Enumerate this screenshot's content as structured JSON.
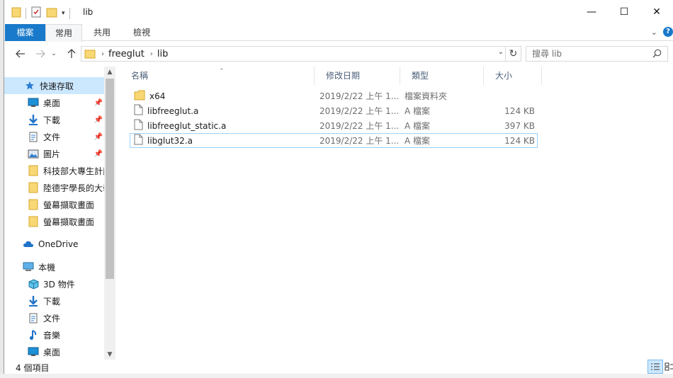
{
  "window": {
    "title": "lib",
    "controls": {
      "minimize": "—",
      "maximize": "☐",
      "close": "✕"
    }
  },
  "ribbon": {
    "tabs": [
      {
        "label": "檔案"
      },
      {
        "label": "常用"
      },
      {
        "label": "共用"
      },
      {
        "label": "檢視"
      }
    ]
  },
  "address": {
    "crumbs": [
      "freeglut",
      "lib"
    ],
    "search_placeholder": "搜尋 lib"
  },
  "nav": {
    "items": [
      {
        "label": "快速存取",
        "icon": "star-icon"
      },
      {
        "label": "桌面",
        "icon": "desktop-icon",
        "pinned": true
      },
      {
        "label": "下載",
        "icon": "download-icon",
        "pinned": true
      },
      {
        "label": "文件",
        "icon": "document-icon",
        "pinned": true
      },
      {
        "label": "圖片",
        "icon": "picture-icon",
        "pinned": true
      },
      {
        "label": "科技部大專生計劃",
        "icon": "folder-icon"
      },
      {
        "label": "陸德宇學長的大學",
        "icon": "folder-icon"
      },
      {
        "label": "螢幕擷取畫面",
        "icon": "folder-icon"
      },
      {
        "label": "螢幕擷取畫面",
        "icon": "folder-icon"
      },
      {
        "label": "OneDrive",
        "icon": "cloud-icon"
      },
      {
        "label": "本機",
        "icon": "computer-icon"
      },
      {
        "label": "3D 物件",
        "icon": "cube-icon"
      },
      {
        "label": "下載",
        "icon": "download-icon"
      },
      {
        "label": "文件",
        "icon": "document-icon"
      },
      {
        "label": "音樂",
        "icon": "music-icon"
      },
      {
        "label": "桌面",
        "icon": "desktop-icon"
      }
    ]
  },
  "columns": {
    "name": "名稱",
    "date": "修改日期",
    "type": "類型",
    "size": "大小"
  },
  "files": [
    {
      "name": "x64",
      "date": "2019/2/22 上午 1...",
      "type": "檔案資料夾",
      "size": "",
      "kind": "folder"
    },
    {
      "name": "libfreeglut.a",
      "date": "2019/2/22 上午 1...",
      "type": "A 檔案",
      "size": "124 KB",
      "kind": "file"
    },
    {
      "name": "libfreeglut_static.a",
      "date": "2019/2/22 上午 1...",
      "type": "A 檔案",
      "size": "397 KB",
      "kind": "file"
    },
    {
      "name": "libglut32.a",
      "date": "2019/2/22 上午 1...",
      "type": "A 檔案",
      "size": "124 KB",
      "kind": "file"
    }
  ],
  "status": {
    "count": "4 個項目"
  },
  "colors": {
    "accent": "#1979ca",
    "selection": "#cce8ff",
    "folder": "#f8d775"
  }
}
